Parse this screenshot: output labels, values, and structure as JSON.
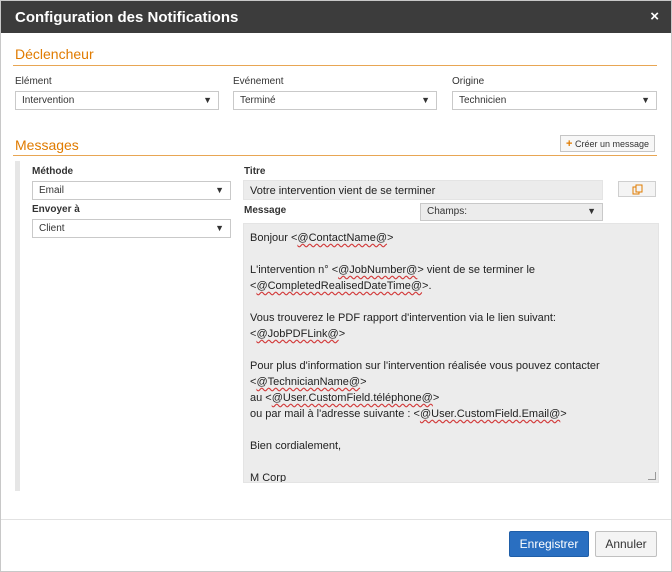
{
  "dialog": {
    "title": "Configuration des Notifications",
    "close_glyph": "×"
  },
  "trigger": {
    "section_title": "Déclencheur",
    "element": {
      "label": "Elément",
      "value": "Intervention"
    },
    "event": {
      "label": "Evénement",
      "value": "Terminé"
    },
    "origin": {
      "label": "Origine",
      "value": "Technicien"
    }
  },
  "messages": {
    "section_title": "Messages",
    "create_button": "Créer un message",
    "method": {
      "label": "Méthode",
      "value": "Email"
    },
    "send_to": {
      "label": "Envoyer à",
      "value": "Client"
    },
    "title_field": {
      "label": "Titre",
      "value": "Votre intervention vient de se terminer"
    },
    "message_label": "Message",
    "fields_select": "Champs:",
    "body": {
      "l1_pre": "Bonjour <",
      "l1_tag": "@ContactName@",
      "l1_post": ">",
      "l2_pre": "L'intervention n° <",
      "l2_tag": "@JobNumber@",
      "l2_post": "> vient de se terminer le",
      "l3_pre": "<",
      "l3_tag": "@CompletedRealisedDateTime@",
      "l3_post": ">.",
      "l4": "Vous trouverez le PDF rapport d'intervention via le lien suivant:",
      "l5_pre": "<",
      "l5_tag": "@JobPDFLink@",
      "l5_post": ">",
      "l6": "Pour plus d'information sur l'intervention réalisée vous pouvez contacter",
      "l7_pre": "<",
      "l7_tag": "@TechnicianName@",
      "l7_post": ">",
      "l8_pre": "au <",
      "l8_tag": "@User.CustomField.téléphone@",
      "l8_post": ">",
      "l9_pre": "ou par mail à l'adresse suivante : <",
      "l9_tag": "@User.CustomField.Email@",
      "l9_post": ">",
      "l10": "Bien cordialement,",
      "l11": "M Corp"
    }
  },
  "footer": {
    "save": "Enregistrer",
    "cancel": "Annuler"
  },
  "icons": {
    "caret": "▼",
    "plus": "+",
    "copy": "copy-icon"
  },
  "colors": {
    "accent": "#e07b00",
    "primary": "#2a6fc1",
    "titlebar": "#3c3c3c"
  }
}
